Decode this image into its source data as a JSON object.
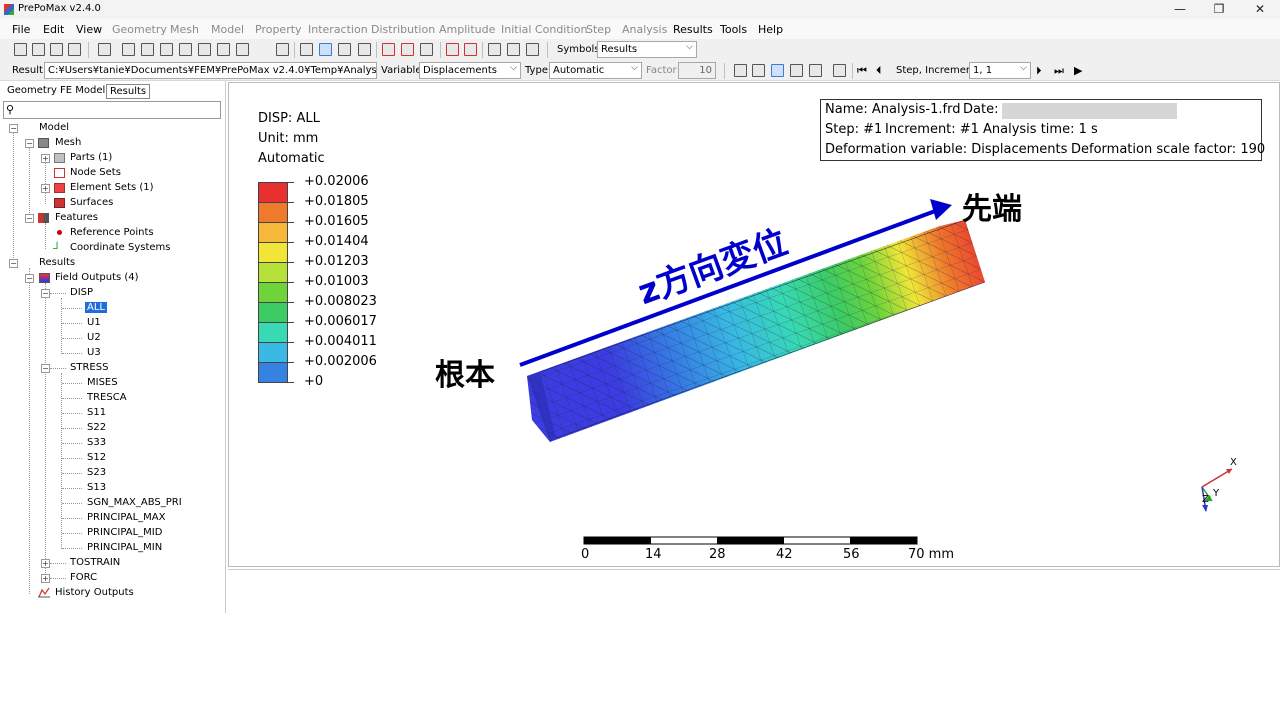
{
  "window": {
    "title": "PrePoMax v2.4.0",
    "min": "—",
    "max": "❐",
    "close": "✕"
  },
  "menu": [
    "File",
    "Edit",
    "View",
    "Geometry",
    "Mesh",
    "Model",
    "Property",
    "Interaction",
    "Distribution",
    "Amplitude",
    "Initial Condition",
    "Step",
    "Analysis",
    "Results",
    "Tools",
    "Help"
  ],
  "toolbar1": {
    "symbols_label": "Symbols",
    "symbols_value": "Results"
  },
  "toolbar2": {
    "result_label": "Result",
    "result_value": "C:¥Users¥tanie¥Documents¥FEM¥PrePoMax v2.4.0¥Temp¥Analysis-1.frd",
    "variable_label": "Variable",
    "variable_value": "Displacements",
    "type_label": "Type",
    "type_value": "Automatic",
    "factor_label": "Factor",
    "factor_value": "10",
    "step_label": "Step, Increment",
    "step_value": "1, 1"
  },
  "tabs": [
    "Geometry",
    "FE Model",
    "Results"
  ],
  "tree": {
    "model": "Model",
    "mesh": "Mesh",
    "parts": "Parts (1)",
    "node_sets": "Node Sets",
    "element_sets": "Element Sets (1)",
    "surfaces": "Surfaces",
    "features": "Features",
    "reference_points": "Reference Points",
    "coordinate_systems": "Coordinate Systems",
    "results": "Results",
    "field_outputs": "Field Outputs (4)",
    "disp": "DISP",
    "disp_items": [
      "ALL",
      "U1",
      "U2",
      "U3"
    ],
    "stress": "STRESS",
    "stress_items": [
      "MISES",
      "TRESCA",
      "S11",
      "S22",
      "S33",
      "S12",
      "S23",
      "S13",
      "SGN_MAX_ABS_PRI",
      "PRINCIPAL_MAX",
      "PRINCIPAL_MID",
      "PRINCIPAL_MIN"
    ],
    "tostrain": "TOSTRAIN",
    "forc": "FORC",
    "history_outputs": "History Outputs"
  },
  "legend": {
    "title": "DISP: ALL",
    "unit": "Unit: mm",
    "mode": "Automatic",
    "values": [
      "+0.02006",
      "+0.01805",
      "+0.01605",
      "+0.01404",
      "+0.01203",
      "+0.01003",
      "+0.008023",
      "+0.006017",
      "+0.004011",
      "+0.002006",
      "+0"
    ],
    "colors": [
      "#e83030",
      "#ef7a2c",
      "#f6b73a",
      "#f1e637",
      "#b7e13a",
      "#6ed43a",
      "#3ccb64",
      "#38d9b4",
      "#39b9e3",
      "#3682e3",
      "#3b3de0"
    ]
  },
  "info": {
    "name": "Name: Analysis-1.frd",
    "date": "Date:",
    "step": "Step: #1",
    "increment": "Increment: #1",
    "time": "Analysis time: 1 s",
    "defvar": "Deformation variable: Displacements",
    "defscale": "Deformation scale factor: 190"
  },
  "scale_bar": {
    "labels": [
      "0",
      "14",
      "28",
      "42",
      "56",
      "70 mm"
    ]
  },
  "annotations": {
    "root": "根本",
    "tip": "先端",
    "arrow": "z方向変位"
  },
  "triad": {
    "x": "X",
    "y": "Y",
    "z": "Z"
  }
}
